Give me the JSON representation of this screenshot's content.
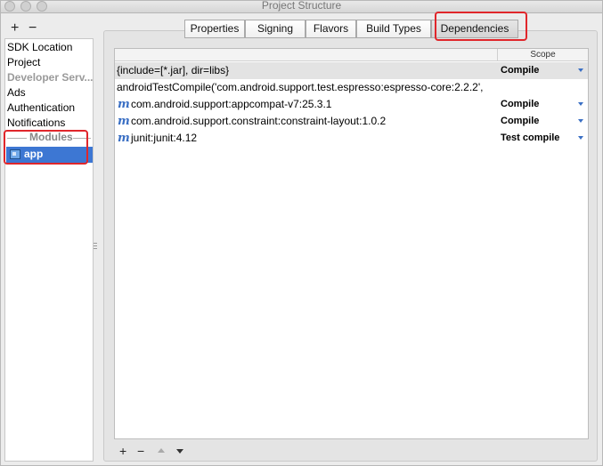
{
  "window": {
    "title": "Project Structure"
  },
  "sidebar": {
    "toolbar": {
      "add_label": "+",
      "remove_label": "−"
    },
    "items": [
      {
        "label": "SDK Location"
      },
      {
        "label": "Project"
      },
      {
        "label": "Developer Serv..."
      },
      {
        "label": "Ads"
      },
      {
        "label": "Authentication"
      },
      {
        "label": "Notifications"
      }
    ],
    "modules_header": "Modules",
    "modules": [
      {
        "label": "app"
      }
    ]
  },
  "tabs": [
    {
      "label": "Properties"
    },
    {
      "label": "Signing"
    },
    {
      "label": "Flavors"
    },
    {
      "label": "Build Types"
    },
    {
      "label": "Dependencies"
    }
  ],
  "table": {
    "scope_header": "Scope",
    "rows": [
      {
        "name": "{include=[*.jar], dir=libs}",
        "scope": "Compile"
      },
      {
        "name": "androidTestCompile('com.android.support.test.espresso:espresso-core:2.2.2',",
        "scope": ""
      },
      {
        "name": "com.android.support:appcompat-v7:25.3.1",
        "scope": "Compile"
      },
      {
        "name": "com.android.support.constraint:constraint-layout:1.0.2",
        "scope": "Compile"
      },
      {
        "name": "junit:junit:4.12",
        "scope": "Test compile"
      }
    ],
    "module_icon_glyph": "m"
  },
  "bottom_toolbar": {
    "add_label": "+",
    "remove_label": "−"
  },
  "colors": {
    "selection": "#3d77d3",
    "highlight_box": "#e0262b",
    "scope_arrow": "#3a6fc4"
  }
}
